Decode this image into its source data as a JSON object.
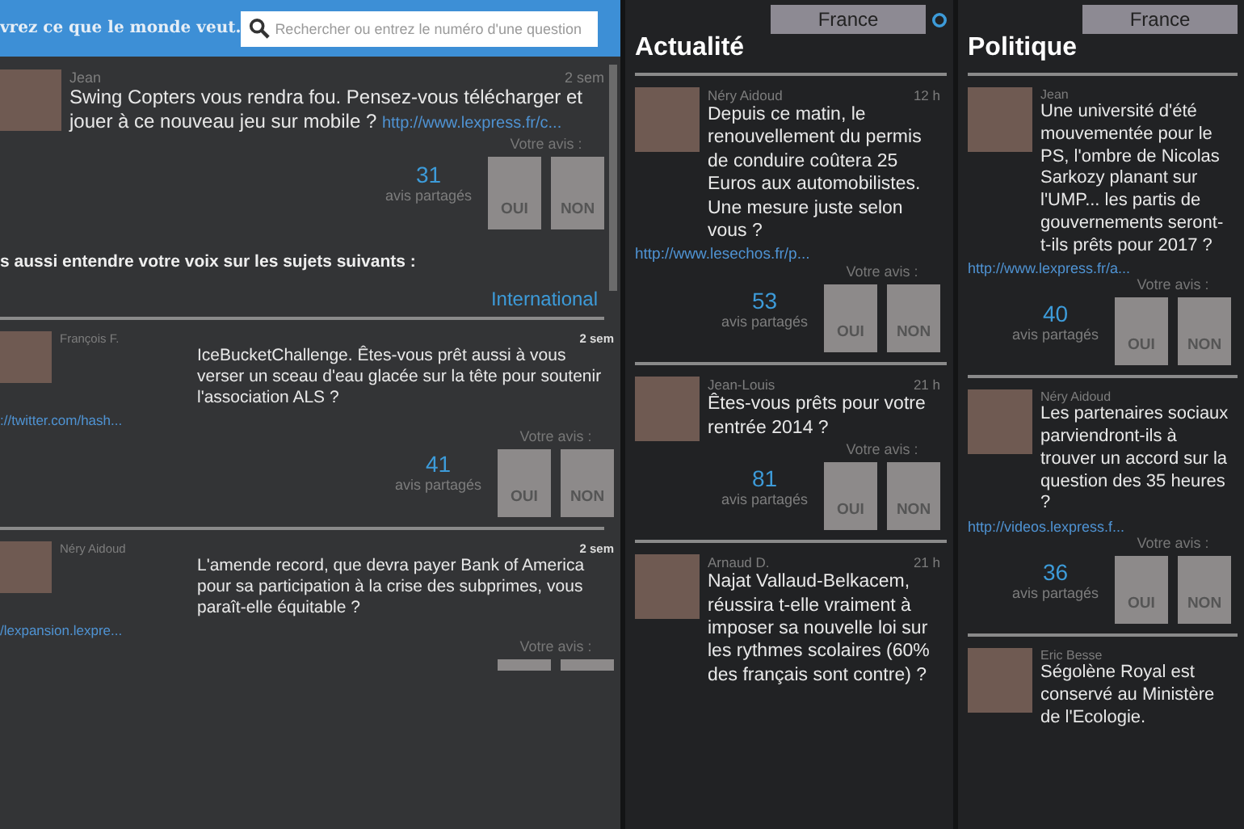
{
  "header": {
    "tagline": "vrez ce que le monde veut.",
    "search": {
      "placeholder": "Rechercher ou entrez le numéro d'une question"
    }
  },
  "feed": {
    "posts": [
      {
        "author": "Jean",
        "time": "2 sem",
        "question": "Swing Copters vous rendra fou. Pensez-vous télécharger et jouer à ce nouveau jeu sur mobile ?",
        "link": "http://www.lexpress.fr/c...",
        "link_inline": true,
        "kind": "full",
        "count": "31",
        "count_label": "avis partagés",
        "vote_label": "Votre avis :",
        "buttons": [
          "OUI",
          "NON"
        ]
      }
    ]
  },
  "suggestions": {
    "heading": "s aussi entendre votre voix sur les sujets suivants :",
    "category": "International",
    "posts": [
      {
        "author": "François F.",
        "time": "2 sem",
        "question": "IceBucketChallenge. Êtes-vous prêt aussi à vous verser un sceau d'eau glacée sur la tête pour soutenir l'association ALS ?",
        "link": "://twitter.com/hash...",
        "link_inline": false,
        "kind": "full",
        "count": "41",
        "count_label": "avis partagés",
        "vote_label": "Votre avis :",
        "buttons": [
          "OUI",
          "NON"
        ]
      },
      {
        "author": "Néry Aidoud",
        "time": "2 sem",
        "question": "L'amende record, que devra payer Bank of America pour sa participation à la crise des subprimes, vous paraît-elle équitable ?",
        "link": "/lexpansion.lexpre...",
        "link_inline": false,
        "kind": "bars",
        "vote_label": "Votre avis :"
      }
    ]
  },
  "columns": [
    {
      "filter": "France",
      "closable": true,
      "title": "Actualité",
      "posts": [
        {
          "author": "Néry Aidoud",
          "time": "12 h",
          "question": "Depuis ce matin, le renouvellement du permis de conduire coûtera 25 Euros aux automobilistes. Une mesure juste selon vous ?",
          "link": "http://www.lesechos.fr/p...",
          "link_inline": false,
          "kind": "full",
          "count": "53",
          "count_label": "avis partagés",
          "vote_label": "Votre avis :",
          "buttons": [
            "OUI",
            "NON"
          ]
        },
        {
          "author": "Jean-Louis",
          "time": "21 h",
          "question": "Êtes-vous prêts pour votre rentrée 2014 ?",
          "link_inline": false,
          "kind": "full",
          "count": "81",
          "count_label": "avis partagés",
          "vote_label": "Votre avis :",
          "buttons": [
            "OUI",
            "NON"
          ]
        },
        {
          "author": "Arnaud D.",
          "time": "21 h",
          "question": "Najat Vallaud-Belkacem, réussira t-elle vraiment à imposer sa nouvelle loi sur les rythmes scolaires (60% des français sont contre) ?",
          "link_inline": false,
          "kind": "none"
        }
      ]
    },
    {
      "filter": "France",
      "title": "Politique",
      "posts": [
        {
          "author": "Jean",
          "question": "Une université d'été mouvementée pour le PS, l'ombre de Nicolas Sarkozy planant sur l'UMP... les partis de gouvernements seront-t-ils prêts pour 2017 ?",
          "link": "http://www.lexpress.fr/a...",
          "link_inline": false,
          "kind": "full",
          "count": "40",
          "count_label": "avis partagés",
          "vote_label": "Votre avis :",
          "buttons": [
            "OUI",
            "NON"
          ]
        },
        {
          "author": "Néry Aidoud",
          "question": "Les partenaires sociaux parviendront-ils à trouver un accord sur la question des 35 heures ?",
          "link": "http://videos.lexpress.f...",
          "link_inline": false,
          "kind": "full",
          "count": "36",
          "count_label": "avis partagés",
          "vote_label": "Votre avis :",
          "buttons": [
            "OUI",
            "NON"
          ]
        },
        {
          "author": "Eric Besse",
          "question": "Ségolène Royal est conservé au Ministère de l'Ecologie.",
          "link_inline": false,
          "kind": "none"
        }
      ]
    }
  ]
}
